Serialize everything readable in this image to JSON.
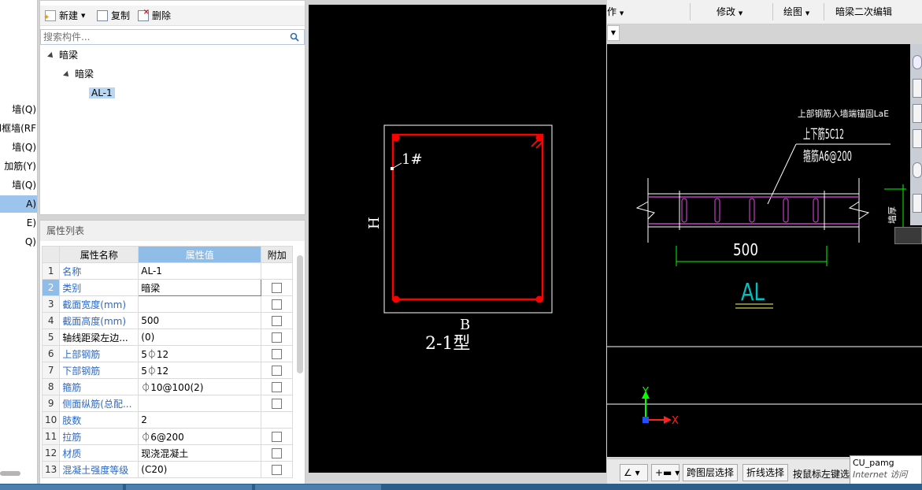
{
  "left_strip": {
    "items": [
      {
        "label": "墙(Q)",
        "selected": false
      },
      {
        "label": "l框墙(RF",
        "selected": false
      },
      {
        "label": "墙(Q)",
        "selected": false
      },
      {
        "label": "加筋(Y)",
        "selected": false
      },
      {
        "label": "墙(Q)",
        "selected": false
      },
      {
        "label": "A)",
        "selected": true
      },
      {
        "label": "E)",
        "selected": false
      },
      {
        "label": "Q)",
        "selected": false
      }
    ]
  },
  "toolbar": {
    "new_label": "新建",
    "copy_label": "复制",
    "delete_label": "删除"
  },
  "search": {
    "placeholder": "搜索构件..."
  },
  "tree": {
    "root": "暗梁",
    "child": "暗梁",
    "leaf": "AL-1"
  },
  "properties": {
    "title": "属性列表",
    "headers": [
      "属性名称",
      "属性值",
      "附加"
    ],
    "rows": [
      {
        "n": "1",
        "name": "名称",
        "value": "AL-1",
        "check": false
      },
      {
        "n": "2",
        "name": "类别",
        "value": "暗梁",
        "check": true
      },
      {
        "n": "3",
        "name": "截面宽度(mm)",
        "value": "",
        "check": true
      },
      {
        "n": "4",
        "name": "截面高度(mm)",
        "value": "500",
        "check": true
      },
      {
        "n": "5",
        "name": "轴线距梁左边...",
        "value": "(0)",
        "check": true
      },
      {
        "n": "6",
        "name": "上部钢筋",
        "value": "5⏀12",
        "check": true
      },
      {
        "n": "7",
        "name": "下部钢筋",
        "value": "5⏀12",
        "check": true
      },
      {
        "n": "8",
        "name": "箍筋",
        "value": "⏀10@100(2)",
        "check": true
      },
      {
        "n": "9",
        "name": "侧面纵筋(总配...",
        "value": "",
        "check": true
      },
      {
        "n": "10",
        "name": "肢数",
        "value": "2",
        "check": false
      },
      {
        "n": "11",
        "name": "拉筋",
        "value": "⏀6@200",
        "check": true
      },
      {
        "n": "12",
        "name": "材质",
        "value": "现浇混凝土",
        "check": true
      },
      {
        "n": "13",
        "name": "混凝土强度等级",
        "value": "(C20)",
        "check": true
      }
    ]
  },
  "section": {
    "h_label": "H",
    "b_label": "B",
    "bar_label": "1#",
    "type_label": "2-1型"
  },
  "top_menu": {
    "items": [
      "作",
      "修改",
      "绘图",
      "暗梁二次编辑"
    ]
  },
  "beam": {
    "note1": "上部钢筋入墙端锚固LaE",
    "note2": "上下筋5C12",
    "note3": "箍筋A6@200",
    "dim": "500",
    "label": "AL",
    "side_text": "墙厚"
  },
  "axes": {
    "x": "X",
    "y": "Y"
  },
  "status_bar": {
    "cross_layer": "跨图层选择",
    "polyline": "折线选择",
    "hint": "按鼠标左键选"
  },
  "tooltip": {
    "line1": "CU_pamg",
    "line2": "Internet 访问"
  },
  "colors": {
    "cad_bg": "#000000",
    "rebar": "#ff0000",
    "stirrup": "#c040c0",
    "dim": "#00ff00",
    "axis_y": "#00ff00",
    "axis_x": "#ff2020",
    "label": "#00c0c0"
  }
}
